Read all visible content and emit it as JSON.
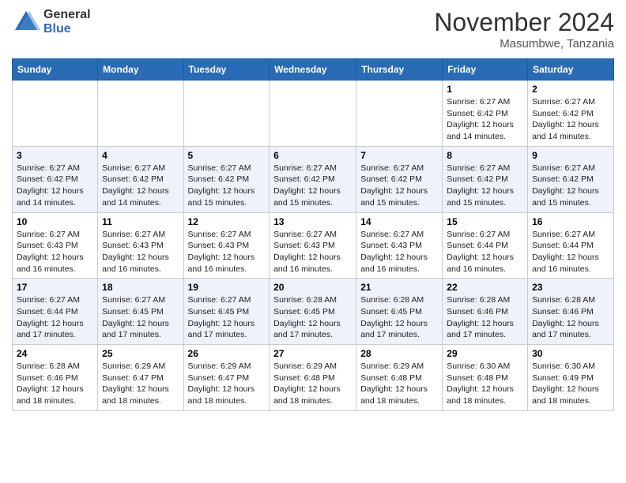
{
  "header": {
    "logo_line1": "General",
    "logo_line2": "Blue",
    "month_title": "November 2024",
    "location": "Masumbwe, Tanzania"
  },
  "calendar": {
    "headers": [
      "Sunday",
      "Monday",
      "Tuesday",
      "Wednesday",
      "Thursday",
      "Friday",
      "Saturday"
    ],
    "rows": [
      [
        {
          "day": "",
          "info": ""
        },
        {
          "day": "",
          "info": ""
        },
        {
          "day": "",
          "info": ""
        },
        {
          "day": "",
          "info": ""
        },
        {
          "day": "",
          "info": ""
        },
        {
          "day": "1",
          "info": "Sunrise: 6:27 AM\nSunset: 6:42 PM\nDaylight: 12 hours\nand 14 minutes."
        },
        {
          "day": "2",
          "info": "Sunrise: 6:27 AM\nSunset: 6:42 PM\nDaylight: 12 hours\nand 14 minutes."
        }
      ],
      [
        {
          "day": "3",
          "info": "Sunrise: 6:27 AM\nSunset: 6:42 PM\nDaylight: 12 hours\nand 14 minutes."
        },
        {
          "day": "4",
          "info": "Sunrise: 6:27 AM\nSunset: 6:42 PM\nDaylight: 12 hours\nand 14 minutes."
        },
        {
          "day": "5",
          "info": "Sunrise: 6:27 AM\nSunset: 6:42 PM\nDaylight: 12 hours\nand 15 minutes."
        },
        {
          "day": "6",
          "info": "Sunrise: 6:27 AM\nSunset: 6:42 PM\nDaylight: 12 hours\nand 15 minutes."
        },
        {
          "day": "7",
          "info": "Sunrise: 6:27 AM\nSunset: 6:42 PM\nDaylight: 12 hours\nand 15 minutes."
        },
        {
          "day": "8",
          "info": "Sunrise: 6:27 AM\nSunset: 6:42 PM\nDaylight: 12 hours\nand 15 minutes."
        },
        {
          "day": "9",
          "info": "Sunrise: 6:27 AM\nSunset: 6:42 PM\nDaylight: 12 hours\nand 15 minutes."
        }
      ],
      [
        {
          "day": "10",
          "info": "Sunrise: 6:27 AM\nSunset: 6:43 PM\nDaylight: 12 hours\nand 16 minutes."
        },
        {
          "day": "11",
          "info": "Sunrise: 6:27 AM\nSunset: 6:43 PM\nDaylight: 12 hours\nand 16 minutes."
        },
        {
          "day": "12",
          "info": "Sunrise: 6:27 AM\nSunset: 6:43 PM\nDaylight: 12 hours\nand 16 minutes."
        },
        {
          "day": "13",
          "info": "Sunrise: 6:27 AM\nSunset: 6:43 PM\nDaylight: 12 hours\nand 16 minutes."
        },
        {
          "day": "14",
          "info": "Sunrise: 6:27 AM\nSunset: 6:43 PM\nDaylight: 12 hours\nand 16 minutes."
        },
        {
          "day": "15",
          "info": "Sunrise: 6:27 AM\nSunset: 6:44 PM\nDaylight: 12 hours\nand 16 minutes."
        },
        {
          "day": "16",
          "info": "Sunrise: 6:27 AM\nSunset: 6:44 PM\nDaylight: 12 hours\nand 16 minutes."
        }
      ],
      [
        {
          "day": "17",
          "info": "Sunrise: 6:27 AM\nSunset: 6:44 PM\nDaylight: 12 hours\nand 17 minutes."
        },
        {
          "day": "18",
          "info": "Sunrise: 6:27 AM\nSunset: 6:45 PM\nDaylight: 12 hours\nand 17 minutes."
        },
        {
          "day": "19",
          "info": "Sunrise: 6:27 AM\nSunset: 6:45 PM\nDaylight: 12 hours\nand 17 minutes."
        },
        {
          "day": "20",
          "info": "Sunrise: 6:28 AM\nSunset: 6:45 PM\nDaylight: 12 hours\nand 17 minutes."
        },
        {
          "day": "21",
          "info": "Sunrise: 6:28 AM\nSunset: 6:45 PM\nDaylight: 12 hours\nand 17 minutes."
        },
        {
          "day": "22",
          "info": "Sunrise: 6:28 AM\nSunset: 6:46 PM\nDaylight: 12 hours\nand 17 minutes."
        },
        {
          "day": "23",
          "info": "Sunrise: 6:28 AM\nSunset: 6:46 PM\nDaylight: 12 hours\nand 17 minutes."
        }
      ],
      [
        {
          "day": "24",
          "info": "Sunrise: 6:28 AM\nSunset: 6:46 PM\nDaylight: 12 hours\nand 18 minutes."
        },
        {
          "day": "25",
          "info": "Sunrise: 6:29 AM\nSunset: 6:47 PM\nDaylight: 12 hours\nand 18 minutes."
        },
        {
          "day": "26",
          "info": "Sunrise: 6:29 AM\nSunset: 6:47 PM\nDaylight: 12 hours\nand 18 minutes."
        },
        {
          "day": "27",
          "info": "Sunrise: 6:29 AM\nSunset: 6:48 PM\nDaylight: 12 hours\nand 18 minutes."
        },
        {
          "day": "28",
          "info": "Sunrise: 6:29 AM\nSunset: 6:48 PM\nDaylight: 12 hours\nand 18 minutes."
        },
        {
          "day": "29",
          "info": "Sunrise: 6:30 AM\nSunset: 6:48 PM\nDaylight: 12 hours\nand 18 minutes."
        },
        {
          "day": "30",
          "info": "Sunrise: 6:30 AM\nSunset: 6:49 PM\nDaylight: 12 hours\nand 18 minutes."
        }
      ]
    ]
  }
}
